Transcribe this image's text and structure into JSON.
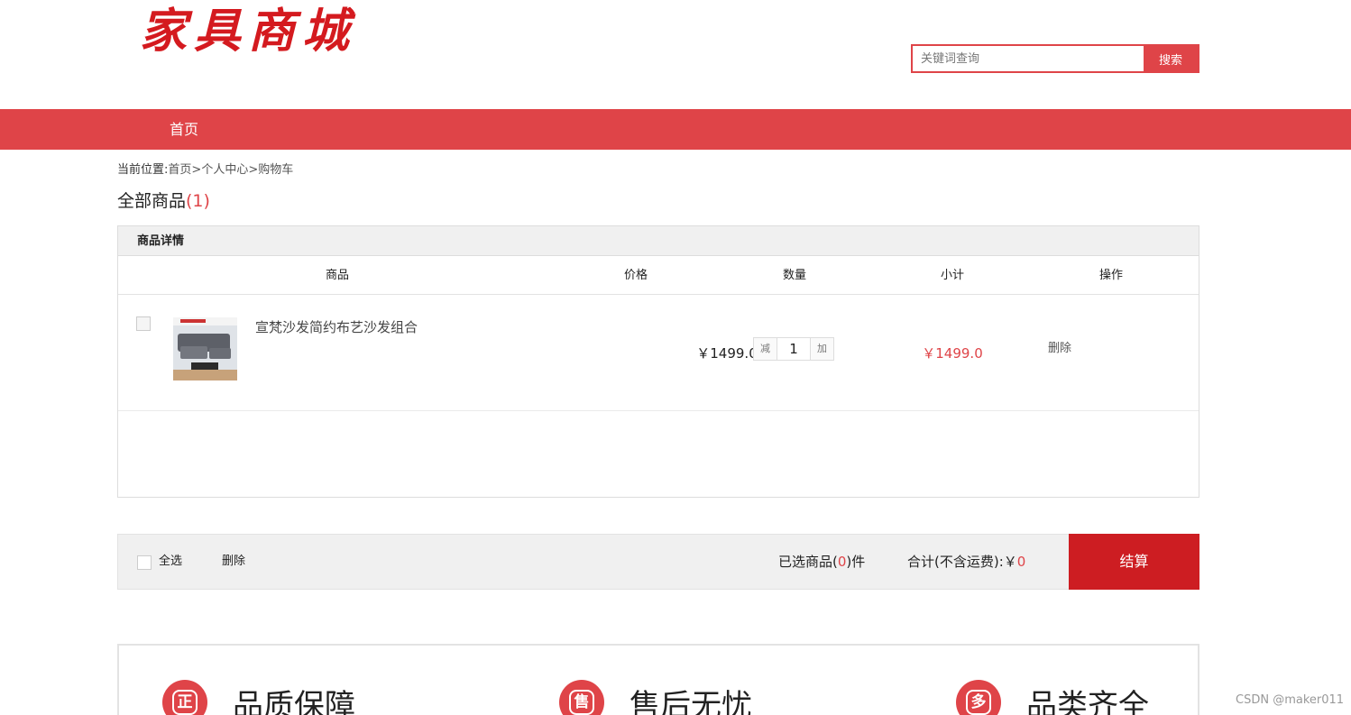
{
  "header": {
    "logo_text": "家具商城",
    "search": {
      "placeholder": "关键词查询",
      "button_label": "搜索"
    }
  },
  "nav": {
    "home_label": "首页"
  },
  "breadcrumb": {
    "prefix": "当前位置:",
    "items": [
      "首页",
      "个人中心",
      "购物车"
    ],
    "separator": ">"
  },
  "cart_title": {
    "label": "全部商品",
    "count": "(1)"
  },
  "cart_table": {
    "panel_title": "商品详情",
    "columns": [
      "商品",
      "价格",
      "数量",
      "小计",
      "操作"
    ],
    "items": [
      {
        "name": "宣梵沙发简约布艺沙发组合",
        "price": "￥1499.0",
        "qty_decrease": "减",
        "quantity": "1",
        "qty_increase": "加",
        "subtotal": "￥1499.0",
        "delete_label": "删除"
      }
    ]
  },
  "footer": {
    "select_all_label": "全选",
    "delete_label": "删除",
    "selected_prefix": "已选商品(",
    "selected_count": "0",
    "selected_suffix": ")件",
    "total_label": "合计(不含运费):￥",
    "total_value": "0",
    "checkout_label": "结算"
  },
  "services": [
    {
      "icon_char": "正",
      "label": "品质保障"
    },
    {
      "icon_char": "售",
      "label": "售后无忧"
    },
    {
      "icon_char": "多",
      "label": "品类齐全"
    }
  ],
  "watermark": "CSDN @maker011",
  "colors": {
    "accent": "#df4448",
    "checkout": "#cd1d22",
    "logo": "#d41a1f"
  }
}
